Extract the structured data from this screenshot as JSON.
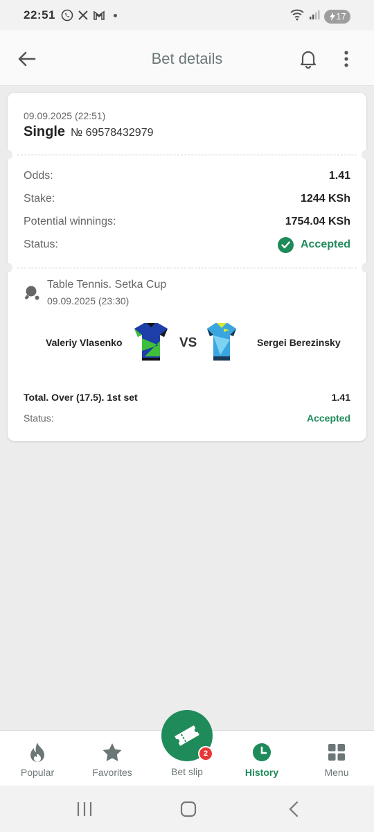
{
  "status_bar": {
    "time": "22:51",
    "battery": "17",
    "icons": [
      "whatsapp-icon",
      "x-icon",
      "gmail-icon",
      "wifi-icon",
      "signal-icon",
      "battery-icon"
    ]
  },
  "header": {
    "title": "Bet details"
  },
  "bet": {
    "date": "09.09.2025 (22:51)",
    "type": "Single",
    "number": "№ 69578432979"
  },
  "details": {
    "odds_label": "Odds:",
    "odds_value": "1.41",
    "stake_label": "Stake:",
    "stake_value": "1244 KSh",
    "winnings_label": "Potential winnings:",
    "winnings_value": "1754.04 KSh",
    "status_label": "Status:",
    "status_value": "Accepted"
  },
  "event": {
    "league": "Table Tennis. Setka Cup",
    "date": "09.09.2025 (23:30)",
    "team1": "Valeriy Vlasenko",
    "vs": "VS",
    "team2": "Sergei Berezinsky",
    "market": "Total. Over (17.5). 1st set",
    "market_odds": "1.41",
    "status_label": "Status:",
    "status_value": "Accepted"
  },
  "bottom_nav": {
    "popular": "Popular",
    "favorites": "Favorites",
    "betslip": "Bet slip",
    "betslip_badge": "2",
    "history": "History",
    "menu": "Menu"
  },
  "colors": {
    "accent": "#1f8a5a",
    "badge": "#e53935",
    "background": "#ececec"
  }
}
